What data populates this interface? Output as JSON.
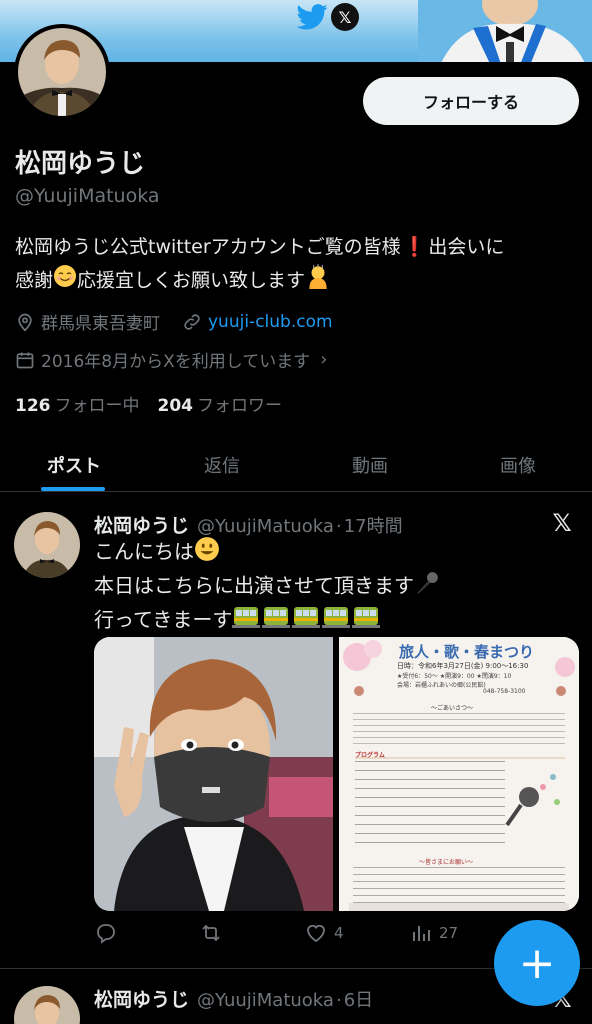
{
  "profile": {
    "name": "松岡ゆうじ",
    "handle": "@YuujiMatuoka",
    "follow_label": "フォローする",
    "bio_line1": "松岡ゆうじ公式twitterアカウントご覧の皆様",
    "bio_line1_end": "出会いに",
    "bio_line2_a": "感謝",
    "bio_line2_b": "応援宜しくお願い致します",
    "location": "群馬県東吾妻町",
    "website": "yuuji-club.com",
    "joined": "2016年8月からXを利用しています",
    "following_count": "126",
    "following_label": "フォロー中",
    "followers_count": "204",
    "followers_label": "フォロワー"
  },
  "tabs": [
    {
      "label": "ポスト"
    },
    {
      "label": "返信"
    },
    {
      "label": "動画"
    },
    {
      "label": "画像"
    }
  ],
  "tweets": [
    {
      "name": "松岡ゆうじ",
      "handle": "@YuujiMatuoka",
      "time": "17時間",
      "line1": "こんにちは",
      "line2": "本日はこちらに出演させて頂きます",
      "line3": "行ってきまーす",
      "replies": "",
      "retweets": "",
      "likes": "4",
      "views": "27"
    },
    {
      "name": "松岡ゆうじ",
      "handle": "@YuujiMatuoka",
      "time": "6日"
    }
  ],
  "poster": {
    "title": "旅人・歌・春まつり",
    "date": "日時：令和6年3月27日(金) 9:00〜16:30",
    "sub": "★受付6：50〜 ★開演9：00 ★閉演9：10",
    "venue": "会場：岩櫃ふれあいの郷(公民館)",
    "tel": "048-758-3100",
    "greet_head": "〜ごあいさつ〜",
    "program_head": "プログラム",
    "notes_head": "〜皆さまにお願い〜"
  },
  "colors": {
    "accent": "#1d9bf0",
    "background": "#000000",
    "secondary_text": "#71767b"
  },
  "icons": [
    "twitter-bird-icon",
    "x-logo-icon",
    "location-icon",
    "link-icon",
    "calendar-icon",
    "reply-icon",
    "retweet-icon",
    "like-icon",
    "views-icon",
    "compose-plus-icon"
  ]
}
